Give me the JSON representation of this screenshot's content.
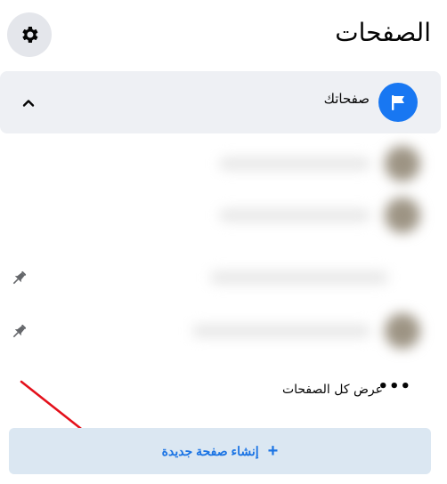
{
  "header": {
    "title": "الصفحات",
    "settings_icon": "gear-icon"
  },
  "section": {
    "label": "صفحاتك",
    "icon": "flag-icon",
    "toggle_icon": "chevron-up-icon"
  },
  "pages": [
    {
      "pinned": false,
      "redacted": true
    },
    {
      "pinned": false,
      "redacted": true
    },
    {
      "pinned": true,
      "redacted": true
    },
    {
      "pinned": true,
      "redacted": true
    }
  ],
  "see_all": {
    "label": "عرض كل الصفحات",
    "icon": "more-dots-icon",
    "dots": "•••"
  },
  "create": {
    "label": "إنشاء صفحة جديدة",
    "icon": "plus-icon",
    "plus": "+"
  },
  "annotation": {
    "arrow_color": "#e4101b"
  },
  "colors": {
    "accent": "#1877f2",
    "section_bg": "#eef0f4",
    "create_bg": "#dbe7f2",
    "create_text": "#1b74e4"
  }
}
